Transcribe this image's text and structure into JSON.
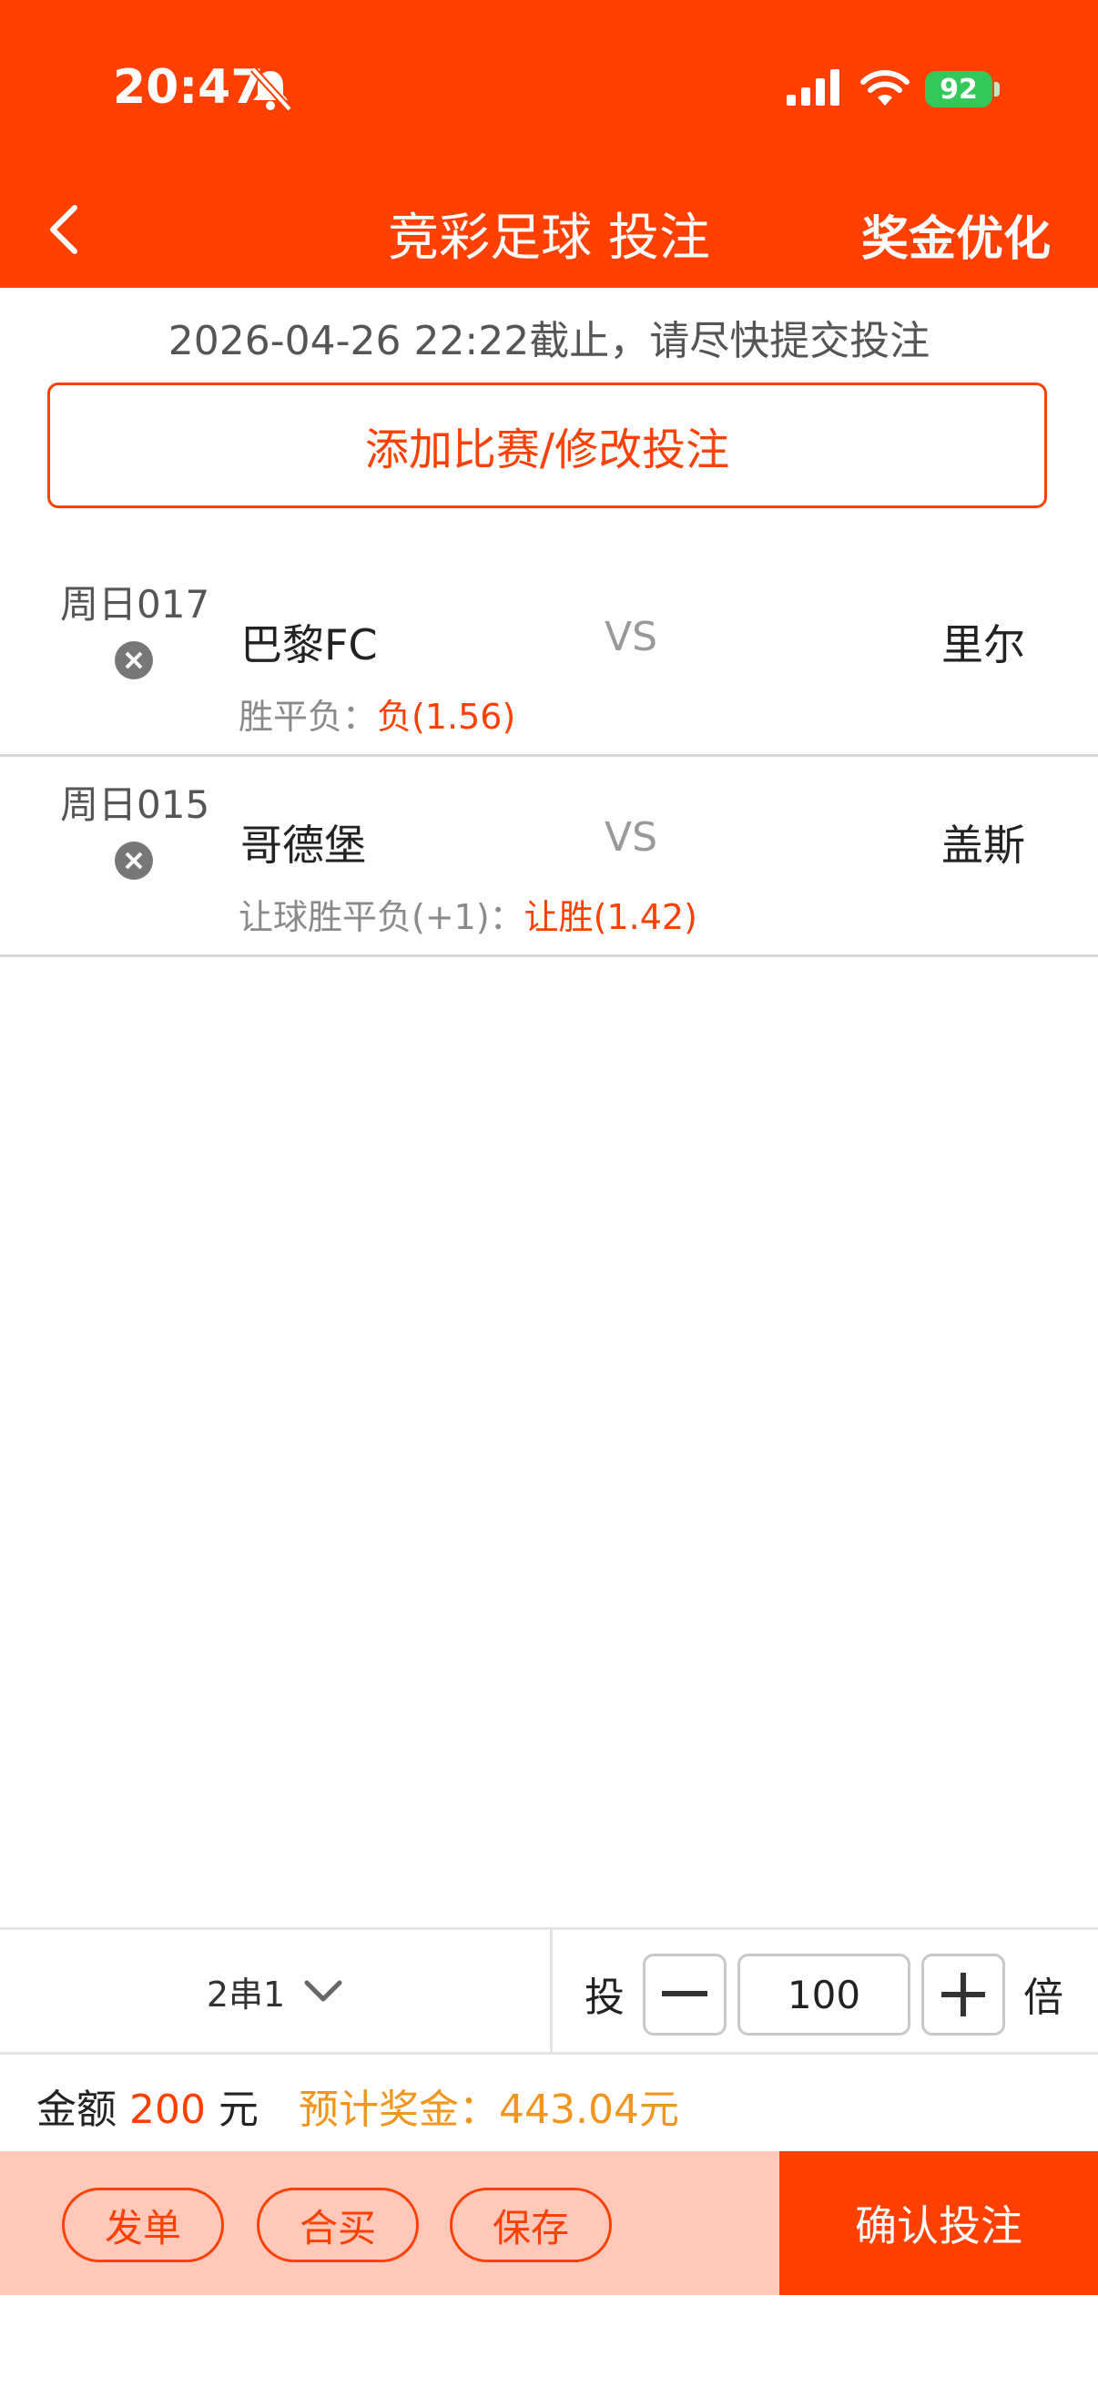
{
  "status_bar": {
    "time": "20:47",
    "battery": "92"
  },
  "nav": {
    "title": "竞彩足球 投注",
    "right_action": "奖金优化"
  },
  "deadline_text": "2026-04-26 22:22截止，请尽快提交投注",
  "add_button": "添加比赛/修改投注",
  "matches": [
    {
      "code": "周日017",
      "home": "巴黎FC",
      "vs": "VS",
      "away": "里尔",
      "play_label": "胜平负：",
      "pick": "负(1.56)"
    },
    {
      "code": "周日015",
      "home": "哥德堡",
      "vs": "VS",
      "away": "盖斯",
      "play_label": "让球胜平负(+1)：",
      "pick": "让胜(1.42)"
    }
  ],
  "bet_bar": {
    "pass_type": "2串1",
    "tou_label": "投",
    "multiplier": "100",
    "bei_label": "倍"
  },
  "summary": {
    "amount_label": "金额",
    "amount": "200",
    "currency": "元",
    "prize": "预计奖金：443.04元"
  },
  "actions": {
    "publish": "发单",
    "group_buy": "合买",
    "save": "保存",
    "confirm": "确认投注"
  },
  "colors": {
    "brand": "#ff4000",
    "prize": "#f0961e"
  }
}
